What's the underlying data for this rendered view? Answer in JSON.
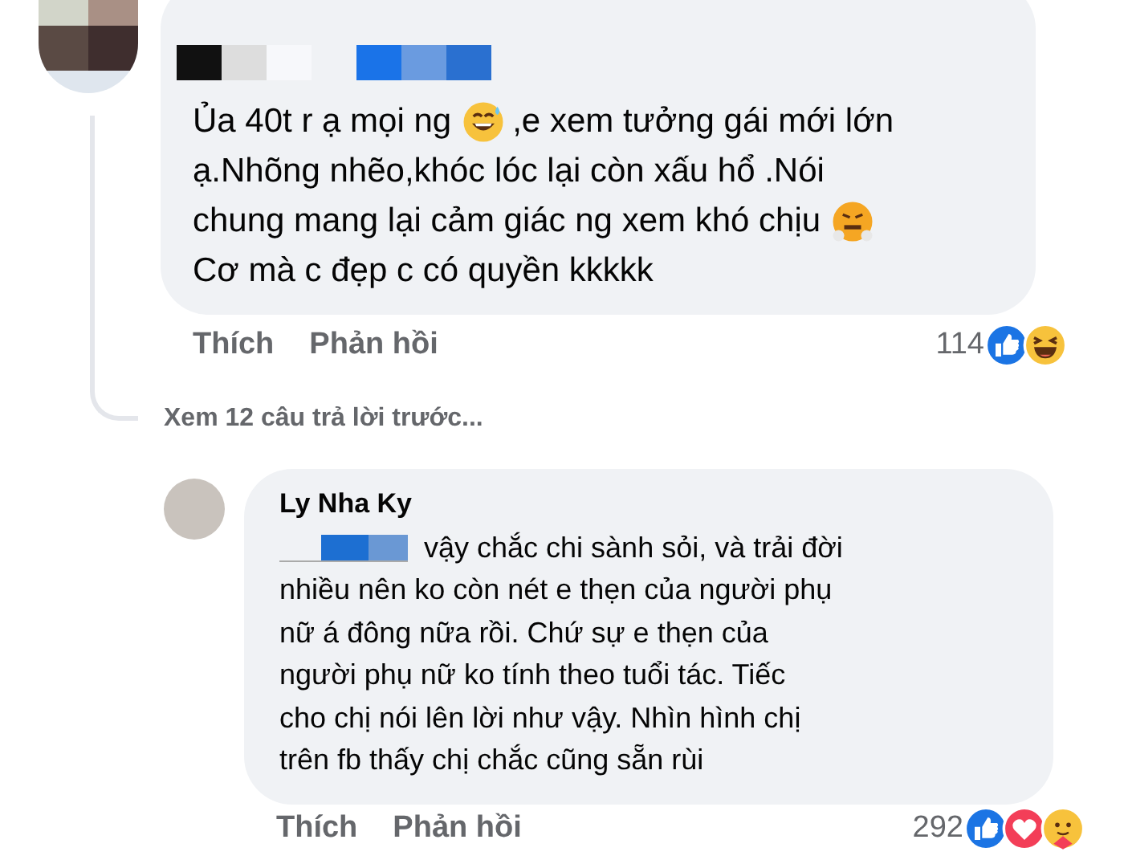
{
  "comments": [
    {
      "kind": "top",
      "name_redacted": true,
      "lines": [
        [
          {
            "kind": "text",
            "text": "Ủa 40t r ạ mọi ng"
          },
          {
            "kind": "sweat_smile_emoji"
          },
          {
            "kind": "text",
            "text": ",e xem tưởng gái mới lớn"
          }
        ],
        [
          {
            "kind": "text",
            "text": "ạ.Nhõng nhẽo,khóc lóc lại còn xấu hổ .Nói"
          }
        ],
        [
          {
            "kind": "text",
            "text": "chung mang lại cảm giác ng xem khó chịu"
          },
          {
            "kind": "steam_emoji"
          }
        ],
        [
          {
            "kind": "text",
            "text": "Cơ mà c đẹp c có quyền kkkkk"
          }
        ]
      ],
      "actions": [
        "Thích",
        "Phản hồi"
      ],
      "reaction_count": "114",
      "reactions": [
        {
          "kind": "like"
        },
        {
          "kind": "haha"
        }
      ]
    },
    {
      "kind": "reply",
      "name": "Ly Nha Ky",
      "lines": [
        [
          {
            "kind": "redaction"
          },
          {
            "kind": "text",
            "text": "vậy chắc chi sành sỏi, và trải đời"
          }
        ],
        [
          {
            "kind": "text",
            "text": "nhiều nên ko còn nét e thẹn của người phụ"
          }
        ],
        [
          {
            "kind": "text",
            "text": "nữ á đông nữa rồi. Chứ sự e thẹn của"
          }
        ],
        [
          {
            "kind": "text",
            "text": "người phụ nữ ko tính theo tuổi tác. Tiếc"
          }
        ],
        [
          {
            "kind": "text",
            "text": "cho chị nói lên lời như vậy. Nhìn hình chị"
          }
        ],
        [
          {
            "kind": "text",
            "text": "trên fb thấy chị chắc cũng sẵn rùi"
          }
        ]
      ],
      "actions": [
        "Thích",
        "Phản hồi"
      ],
      "reaction_count": "292",
      "reactions": [
        {
          "kind": "like"
        },
        {
          "kind": "love"
        },
        {
          "kind": "care"
        }
      ]
    }
  ],
  "more_replies": "Xem 12 câu trả lời trước..."
}
